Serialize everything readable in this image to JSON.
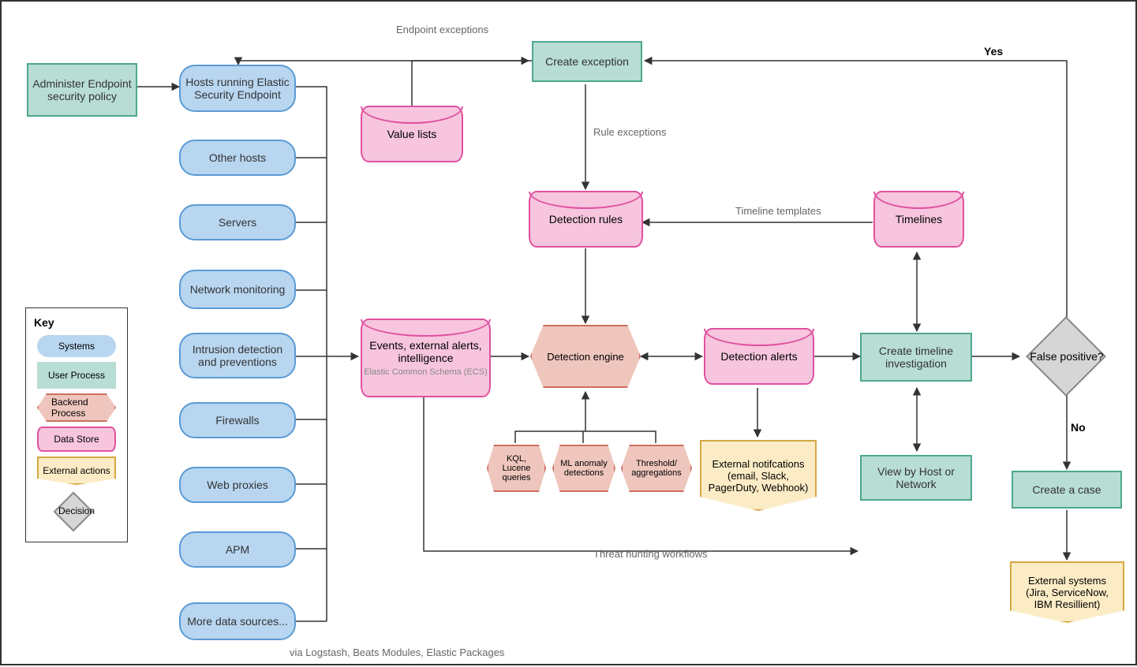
{
  "key": {
    "title": "Key",
    "systems": "Systems",
    "userProcess": "User Process",
    "backendProcess": "Backend Process",
    "dataStore": "Data Store",
    "externalActions": "External actions",
    "decision": "Decision"
  },
  "nodes": {
    "admin": "Administer Endpoint security policy",
    "hostsRunning": "Hosts running Elastic Security Endpoint",
    "otherHosts": "Other hosts",
    "servers": "Servers",
    "netMon": "Network monitoring",
    "ids": "Intrusion detection and preventions",
    "firewalls": "Firewalls",
    "webProxies": "Web proxies",
    "apm": "APM",
    "moreData": "More data sources...",
    "createException": "Create exception",
    "valueLists": "Value lists",
    "detectionRules": "Detection rules",
    "timelines": "Timelines",
    "events": "Events, external alerts, intelligence",
    "eventsSub": "Elastic Common Schema (ECS)",
    "detectionEngine": "Detection engine",
    "detectionAlerts": "Detection alerts",
    "createTimeline": "Create timeline investigation",
    "falsePositive": "False positive?",
    "kql": "KQL, Lucene queries",
    "ml": "ML anomaly detections",
    "threshold": "Threshold/ aggregations",
    "extNotif": "External notifcations (email, Slack, PagerDuty, Webhook)",
    "viewBy": "View by Host or Network",
    "createCase": "Create a case",
    "extSystems": "External systems (Jira, ServiceNow, IBM Resillient)"
  },
  "edges": {
    "endpointExceptions": "Endpoint exceptions",
    "ruleExceptions": "Rule exceptions",
    "timelineTemplates": "Timeline templates",
    "threatHunting": "Threat hunting workflows",
    "via": "via Logstash, Beats Modules, Elastic Packages",
    "yes": "Yes",
    "no": "No"
  }
}
